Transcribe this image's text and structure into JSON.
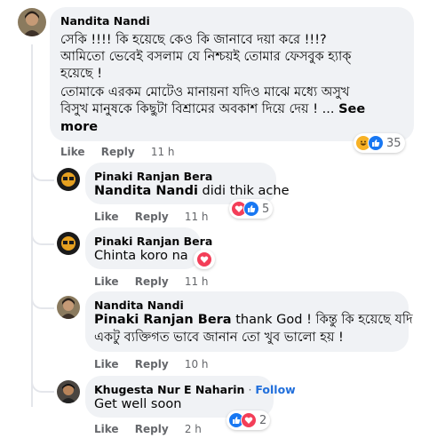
{
  "comments": [
    {
      "author": "Nandita Nandi",
      "lines": [
        "সেকি !!!! কি হয়েছে কেও কি জানাবে দয়া করে !!!?",
        "আমিতো ভেবেই বসলাম যে নিশ্চয়ই তোমার ফেসবুক হ্যাক্",
        "হয়েছে !",
        "তোমাকে এরকম মোটেও মানায়না যদিও মাঝে মধ্যে অসুখ",
        "বিসুখ মানুষকে কিছুটা বিশ্রামের অবকাশ দিয়ে দেয় ! ..."
      ],
      "see_more": "See more",
      "see_more_first": "See",
      "see_more_second": "more",
      "like": "Like",
      "reply": "Reply",
      "time": "11 h",
      "reaction_count": "35"
    },
    {
      "author": "Pinaki Ranjan Bera",
      "mention": "Nandita Nandi",
      "text": " didi thik ache",
      "like": "Like",
      "reply": "Reply",
      "time": "11 h",
      "reaction_count": "5"
    },
    {
      "author": "Pinaki Ranjan Bera",
      "text": "Chinta koro na",
      "like": "Like",
      "reply": "Reply",
      "time": "11 h"
    },
    {
      "author": "Nandita Nandi",
      "mention": "Pinaki Ranjan Bera",
      "line1_rest": " thank God ! কিন্তু কি হয়েছে যদি",
      "line2": "একটু ব্যক্তিগত ভাবে জানান তো খুব ভালো হয় !",
      "like": "Like",
      "reply": "Reply",
      "time": "10 h"
    },
    {
      "author": "Khugesta Nur E Naharin",
      "separator": " · ",
      "follow": "Follow",
      "text": "Get well soon",
      "like": "Like",
      "reply": "Reply",
      "time": "2 h",
      "reaction_count": "2"
    }
  ],
  "colors": {
    "bubble": "#f0f2f5",
    "secondary_text": "#65676b",
    "link": "#216fdb",
    "like_blue": "#1877f2",
    "love_red": "#f33e58",
    "haha_yellow": "#f7b125"
  },
  "icons": [
    "haha-icon",
    "like-icon",
    "love-icon"
  ]
}
